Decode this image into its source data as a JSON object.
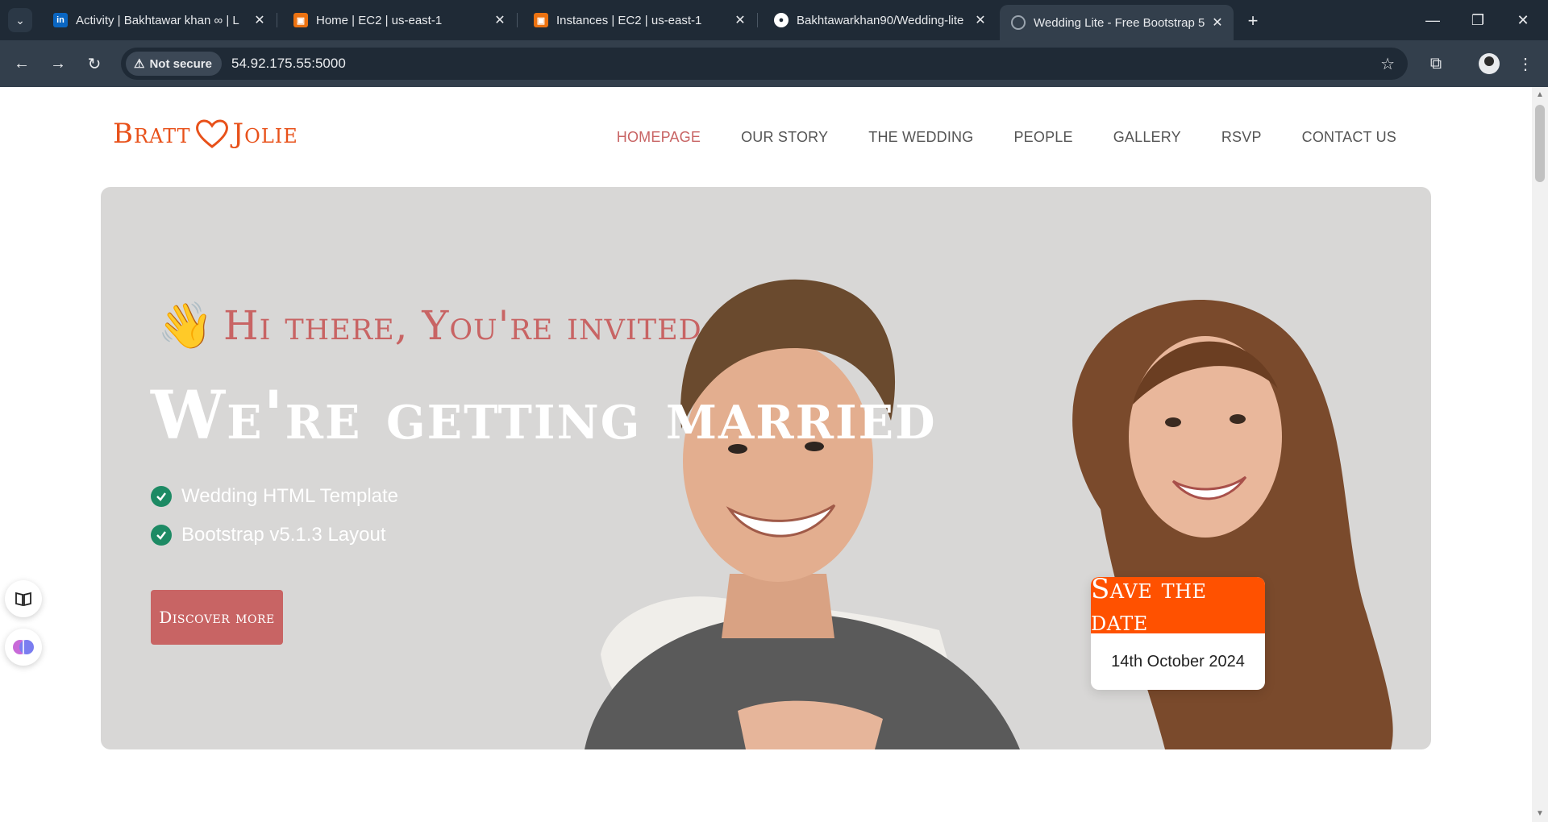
{
  "browser": {
    "tabs": [
      {
        "title": "Activity | Bakhtawar khan ∞ | L",
        "favicon": "linkedin-icon",
        "active": false
      },
      {
        "title": "Home | EC2 | us-east-1",
        "favicon": "aws-ec2-icon",
        "active": false
      },
      {
        "title": "Instances | EC2 | us-east-1",
        "favicon": "aws-ec2-icon",
        "active": false
      },
      {
        "title": "Bakhtawarkhan90/Wedding-lite",
        "favicon": "github-icon",
        "active": false
      },
      {
        "title": "Wedding Lite - Free Bootstrap 5",
        "favicon": "globe-icon",
        "active": true
      }
    ],
    "security_label": "Not secure",
    "url": "54.92.175.55:5000"
  },
  "site": {
    "logo": {
      "left": "Bratt",
      "right": "Jolie"
    },
    "nav": [
      {
        "label": "HOMEPAGE",
        "active": true
      },
      {
        "label": "OUR STORY",
        "active": false
      },
      {
        "label": "THE WEDDING",
        "active": false
      },
      {
        "label": "PEOPLE",
        "active": false
      },
      {
        "label": "GALLERY",
        "active": false
      },
      {
        "label": "RSVP",
        "active": false
      },
      {
        "label": "CONTACT US",
        "active": false
      }
    ],
    "hero": {
      "invite": "Hi there, You're invited",
      "title": "We're getting married",
      "features": [
        "Wedding HTML Template",
        "Bootstrap v5.1.3 Layout"
      ],
      "cta": "Discover more",
      "save_the_date": {
        "heading": "Save the date",
        "date": "14th October 2024"
      }
    }
  },
  "colors": {
    "brand": "#e8511a",
    "accent": "#c86464",
    "save_date": "#ff5100",
    "check": "#1d8a64",
    "hero_bg": "#d8d7d6"
  }
}
